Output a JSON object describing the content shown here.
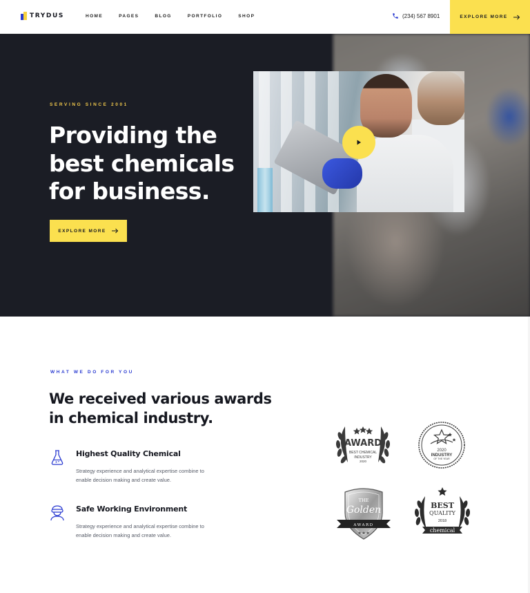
{
  "brand": {
    "name": "TRYDUS",
    "colors": {
      "accent": "#fbe04f",
      "blue": "#2a3bd1",
      "dark": "#1b1d25"
    }
  },
  "nav": {
    "items": [
      "HOME",
      "PAGES",
      "BLOG",
      "PORTFOLIO",
      "SHOP"
    ]
  },
  "header": {
    "phone": "(234) 567 8901",
    "cta_label": "EXPLORE MORE",
    "phone_icon": "phone-icon",
    "arrow_icon": "arrow-right-icon"
  },
  "hero": {
    "eyebrow": "SERVING SINCE 2001",
    "title": "Providing the best chemicals for business.",
    "cta_label": "EXPLORE MORE",
    "play_icon": "play-icon"
  },
  "awards_section": {
    "eyebrow": "WHAT WE DO FOR YOU",
    "title": "We received various awards in chemical industry.",
    "features": [
      {
        "icon": "flask-icon",
        "title": "Highest Quality Chemical",
        "description": "Strategy experience and analytical expertise combine to enable decision making and create value."
      },
      {
        "icon": "scientist-icon",
        "title": "Safe Working Environment",
        "description": "Strategy experience and analytical expertise combine to enable decision making and create value."
      }
    ],
    "badges": {
      "award": {
        "title": "AWARD",
        "line1": "BEST CHEMICAL",
        "line2": "INDUSTRY",
        "year": "2020"
      },
      "industry": {
        "year": "2020",
        "title": "INDUSTRY",
        "sub": "OF THE YEAR"
      },
      "golden": {
        "the": "THE",
        "golden": "Golden",
        "award": "AWARD"
      },
      "quality": {
        "best": "BEST",
        "quality": "QUALITY",
        "year": "2018",
        "ribbon": "chemical"
      }
    }
  }
}
